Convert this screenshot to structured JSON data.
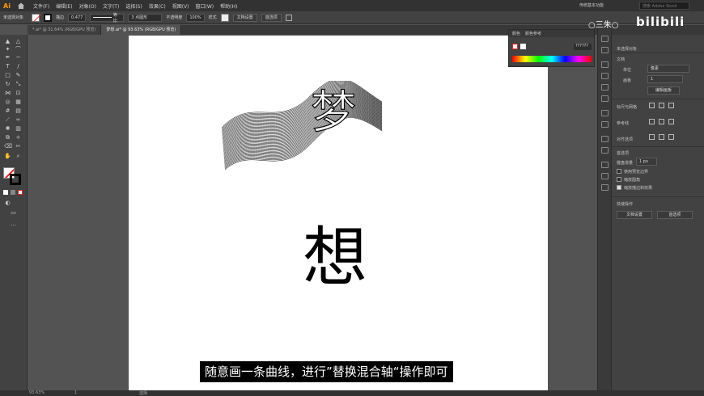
{
  "menubar": {
    "logo": "Ai",
    "items": [
      "文件(F)",
      "编辑(E)",
      "对象(O)",
      "文字(T)",
      "选择(S)",
      "效果(C)",
      "视图(V)",
      "窗口(W)",
      "帮助(H)"
    ],
    "workspace": "传统基本功能",
    "search_placeholder": "搜索 Adobe Stock"
  },
  "controlbar": {
    "selection_label": "未选择对象",
    "stroke_label": "描边",
    "stroke_value": "0.477",
    "stroke_style": "等比",
    "brush_value": "3 点圆形",
    "opacity_label": "不透明度",
    "opacity_value": "100%",
    "style_label": "样式",
    "doc_setup_btn": "文档设置",
    "prefs_btn": "首选项"
  },
  "tabs": [
    {
      "label": "*.ai* @ 31.64% (RGB/GPU 预览)",
      "active": false
    },
    {
      "label": "梦想.ai* @ 93.63% (RGB/GPU 预览)",
      "active": true
    }
  ],
  "canvas": {
    "art_char": "梦",
    "big_char": "想"
  },
  "subtitle": "随意画一条曲线，进行”替换混合轴“操作即可",
  "color_panel": {
    "tab1": "颜色",
    "tab2": "颜色参考",
    "hex_value": "??????"
  },
  "props_panel": {
    "title": "未选择对象",
    "doc_section": "文档",
    "unit_label": "单位",
    "unit_value": "像素",
    "artboard_label": "画板",
    "artboard_value": "1",
    "edit_artboard_btn": "编辑画板",
    "ruler_section": "标尺与网格",
    "guides_section": "参考线",
    "snap_section": "对齐选项",
    "prefs_section": "首选项",
    "keyboard_inc_label": "键盘增量",
    "keyboard_inc_value": "1 px",
    "check1": "使用预览边界",
    "check2": "缩放圆角",
    "check3": "缩放描边和效果",
    "quick_section": "快速操作",
    "doc_setup_btn": "文档设置",
    "prefs_btn": "首选项"
  },
  "watermark": {
    "left": "○三朱○",
    "brand": "bilibili"
  },
  "status": {
    "zoom": "93.63%",
    "page": "1",
    "tool": "选择"
  },
  "colors": {
    "accent": "#ff9a00",
    "panel_bg": "#424242",
    "canvas_bg": "#535353"
  }
}
